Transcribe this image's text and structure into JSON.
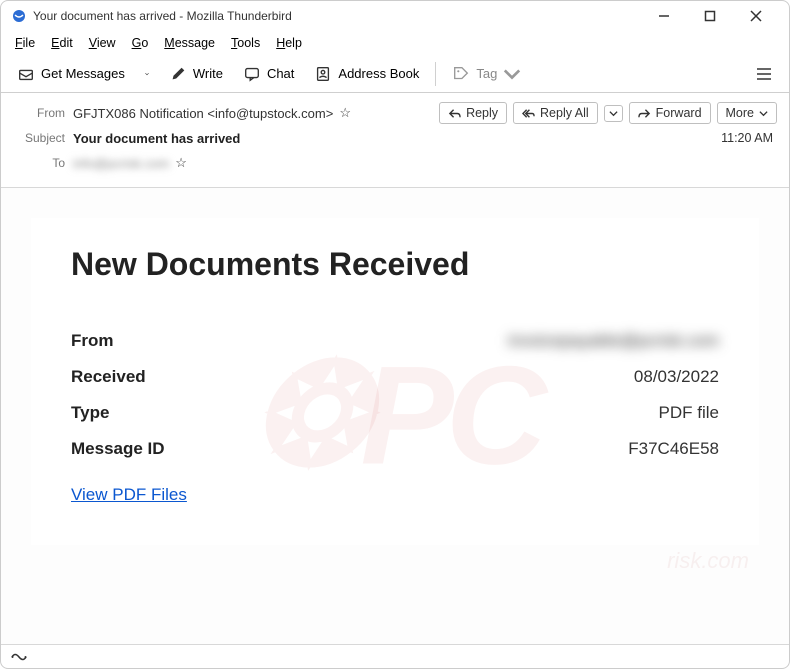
{
  "window": {
    "title": "Your document has arrived - Mozilla Thunderbird"
  },
  "menubar": {
    "file": "File",
    "edit": "Edit",
    "view": "View",
    "go": "Go",
    "message": "Message",
    "tools": "Tools",
    "help": "Help"
  },
  "toolbar": {
    "get_messages": "Get Messages",
    "write": "Write",
    "chat": "Chat",
    "address_book": "Address Book",
    "tag": "Tag"
  },
  "header": {
    "from_label": "From",
    "from_value": "GFJTX086 Notification <info@tupstock.com>",
    "subject_label": "Subject",
    "subject_value": "Your document has arrived",
    "to_label": "To",
    "to_value": "info@pcrisk.com",
    "reply": "Reply",
    "reply_all": "Reply All",
    "forward": "Forward",
    "more": "More",
    "time": "11:20 AM"
  },
  "email": {
    "title": "New Documents Received",
    "rows": {
      "from_k": "From",
      "from_v": "invoicepayable@pcrisk.com",
      "received_k": "Received",
      "received_v": "08/03/2022",
      "type_k": "Type",
      "type_v": "PDF file",
      "msgid_k": "Message ID",
      "msgid_v": "F37C46E58"
    },
    "view_link": "View PDF Files"
  }
}
